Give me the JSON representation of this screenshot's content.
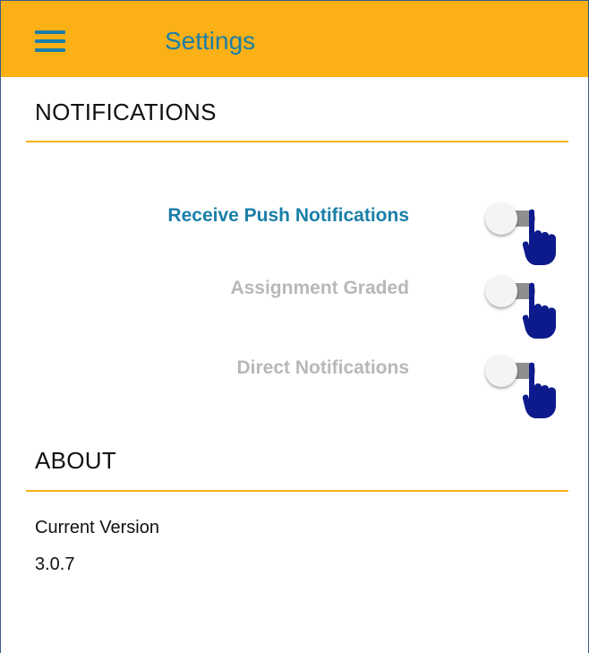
{
  "app_bar": {
    "title": "Settings",
    "menu_icon": "hamburger-menu-icon",
    "background_color": "#fbb016",
    "accent_color": "#1a7fa8"
  },
  "notifications": {
    "heading": "NOTIFICATIONS",
    "settings": [
      {
        "label": "Receive Push Notifications",
        "enabled": true,
        "checked": false
      },
      {
        "label": "Assignment Graded",
        "enabled": false,
        "checked": false
      },
      {
        "label": "Direct Notifications",
        "enabled": false,
        "checked": false
      }
    ],
    "pointer_icon": "pointing-hand-icon"
  },
  "about": {
    "heading": "ABOUT",
    "version_label": "Current Version",
    "version_value": "3.0.7"
  }
}
